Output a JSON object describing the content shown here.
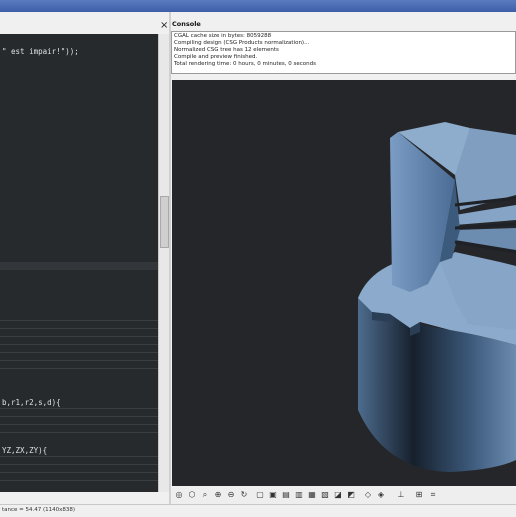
{
  "editor": {
    "close_glyph": "×",
    "lines": [
      {
        "text": "\" est impair!\"));"
      },
      {
        "text": "b,r1,r2,s,d){"
      },
      {
        "text": "YZ,ZX,ZY){"
      }
    ]
  },
  "console": {
    "title": "Console",
    "lines": [
      "CGAL cache size in bytes: 8059288",
      "Compiling design (CSG Products normalization)...",
      "Normalized CSG tree has 12 elements",
      "Compile and preview finished.",
      "Total rendering time: 0 hours, 0 minutes, 0 seconds"
    ]
  },
  "toolbar": {
    "icons": [
      "render-icon",
      "preview-icon",
      "zoom-all-icon",
      "zoom-in-icon",
      "zoom-out-icon",
      "reset-view-icon",
      "view-right-icon",
      "view-top-icon",
      "view-bottom-icon",
      "view-left-icon",
      "view-front-icon",
      "view-back-icon",
      "view-diagonal-icon",
      "view-center-icon",
      "perspective-icon",
      "orthographic-icon",
      "show-axes-icon",
      "show-scale-icon",
      "show-edges-icon"
    ]
  },
  "status": {
    "text": "tance = 54.47 (1140x838)"
  },
  "colors": {
    "model_face": "#8aa8c8",
    "viewport_bg": "#252629",
    "editor_bg": "#272a2d"
  }
}
